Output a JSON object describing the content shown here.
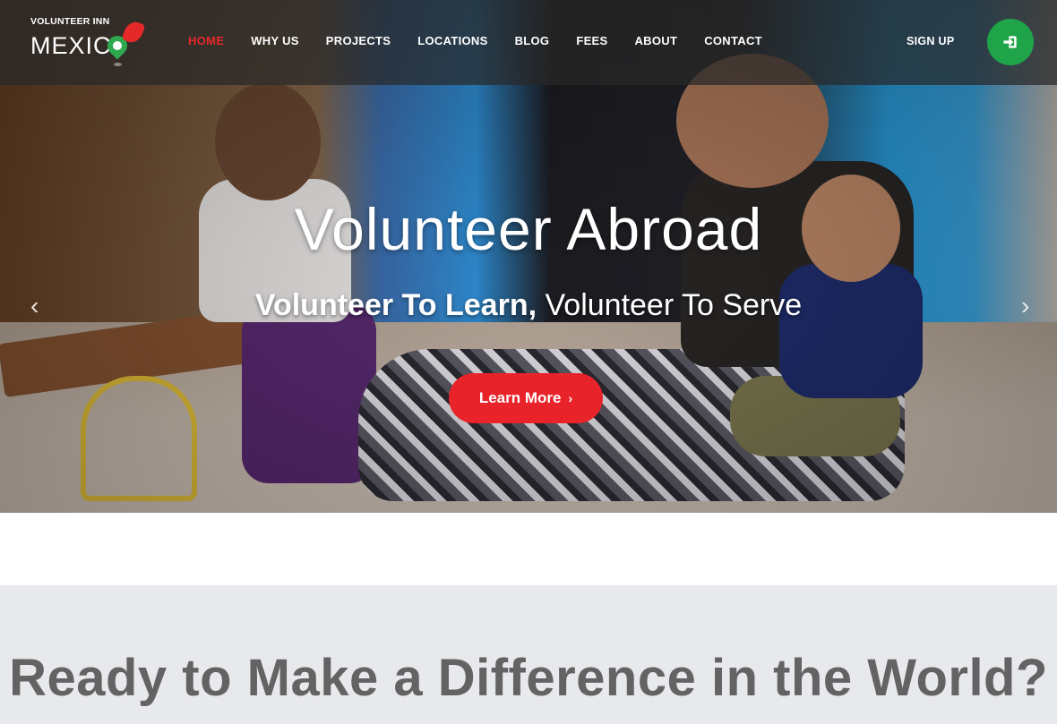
{
  "brand": {
    "logo_small": "VOLUNTEER INN",
    "logo_big": "MEXIC",
    "accent_red": "#e8232a",
    "accent_green": "#1fa44a"
  },
  "nav": {
    "items": [
      {
        "label": "HOME",
        "active": true
      },
      {
        "label": "WHY US",
        "active": false
      },
      {
        "label": "PROJECTS",
        "active": false
      },
      {
        "label": "LOCATIONS",
        "active": false
      },
      {
        "label": "BLOG",
        "active": false
      },
      {
        "label": "FEES",
        "active": false
      },
      {
        "label": "ABOUT",
        "active": false
      },
      {
        "label": "CONTACT",
        "active": false
      }
    ],
    "signup_label": "SIGN UP",
    "login_icon": "sign-in-icon"
  },
  "hero": {
    "title": "Volunteer Abroad",
    "subtitle_bold": "Volunteer To Learn,",
    "subtitle_light": "Volunteer To Serve",
    "cta_label": "Learn More",
    "cta_icon": "chevron-right-icon",
    "prev_icon": "chevron-left-icon",
    "next_icon": "chevron-right-icon",
    "prev_glyph": "‹",
    "next_glyph": "›",
    "cta_glyph": "›"
  },
  "section": {
    "heading": "Ready to Make a Difference in the World?"
  }
}
